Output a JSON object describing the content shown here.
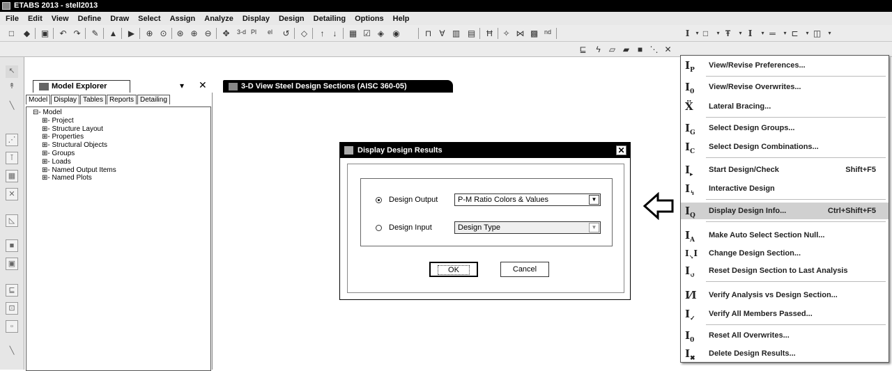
{
  "window": {
    "title": "ETABS 2013  - stell2013"
  },
  "menu": [
    "File",
    "Edit",
    "View",
    "Define",
    "Draw",
    "Select",
    "Assign",
    "Analyze",
    "Display",
    "Design",
    "Detailing",
    "Options",
    "Help"
  ],
  "toolbar": {
    "text_3d": "3-d",
    "text_pl": "Pl",
    "text_el": "el",
    "text_nd": "nd"
  },
  "explorer": {
    "title": "Model Explorer",
    "tabs": [
      "Model",
      "Display",
      "Tables",
      "Reports",
      "Detailing"
    ],
    "tree_root": "Model",
    "tree_items": [
      "Project",
      "Structure Layout",
      "Properties",
      "Structural Objects",
      "Groups",
      "Loads",
      "Named Output Items",
      "Named Plots"
    ]
  },
  "view_tab": {
    "title": "3-D View  Steel Design Sections  (AISC 360-05)"
  },
  "dialog": {
    "title": "Display Design Results",
    "option1_label": "Design Output",
    "option1_value": "P-M Ratio Colors & Values",
    "option2_label": "Design Input",
    "option2_value": "Design Type",
    "selected": "Design Output",
    "ok_label": "OK",
    "cancel_label": "Cancel"
  },
  "design_menu": [
    {
      "label": "View/Revise Preferences...",
      "shortcut": "",
      "icon": "preferences-icon"
    },
    {
      "label": "View/Revise Overwrites...",
      "shortcut": "",
      "icon": "overwrites-icon"
    },
    {
      "label": "Lateral Bracing...",
      "shortcut": "",
      "icon": "lateral-bracing-icon"
    },
    {
      "label": "Select Design Groups...",
      "shortcut": "",
      "icon": "design-groups-icon"
    },
    {
      "label": "Select Design Combinations...",
      "shortcut": "",
      "icon": "design-combinations-icon"
    },
    {
      "label": "Start Design/Check",
      "shortcut": "Shift+F5",
      "icon": "start-design-icon"
    },
    {
      "label": "Interactive Design",
      "shortcut": "",
      "icon": "interactive-design-icon"
    },
    {
      "label": "Display Design Info...",
      "shortcut": "Ctrl+Shift+F5",
      "icon": "display-design-info-icon",
      "highlighted": true
    },
    {
      "label": "Make Auto Select Section Null...",
      "shortcut": "",
      "icon": "auto-select-null-icon"
    },
    {
      "label": "Change Design Section...",
      "shortcut": "",
      "icon": "change-section-icon"
    },
    {
      "label": "Reset Design Section to Last Analysis",
      "shortcut": "",
      "icon": "reset-section-icon"
    },
    {
      "label": "Verify Analysis vs Design Section...",
      "shortcut": "",
      "icon": "verify-analysis-icon"
    },
    {
      "label": "Verify All Members Passed...",
      "shortcut": "",
      "icon": "verify-members-icon"
    },
    {
      "label": "Reset All Overwrites...",
      "shortcut": "",
      "icon": "reset-overwrites-icon"
    },
    {
      "label": "Delete Design Results...",
      "shortcut": "",
      "icon": "delete-results-icon"
    }
  ]
}
